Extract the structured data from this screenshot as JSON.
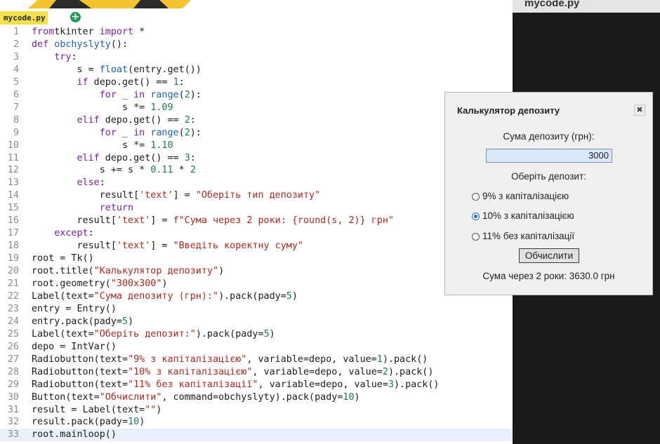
{
  "tab": {
    "file_name": "mycode.py",
    "add_icon": "plus-circle-icon",
    "add_glyph": "+"
  },
  "right_panel": {
    "title": "mycode.py"
  },
  "code_lines": [
    {
      "n": "1",
      "segs": [
        [
          "kw",
          "from"
        ],
        [
          "",
          "tkinter "
        ],
        [
          "kw",
          "import"
        ],
        [
          "",
          " *"
        ]
      ]
    },
    {
      "n": "2",
      "segs": [
        [
          "kw",
          "def"
        ],
        [
          "",
          " "
        ],
        [
          "fn",
          "obchyslyty"
        ],
        [
          "",
          "():"
        ]
      ]
    },
    {
      "n": "3",
      "segs": [
        [
          "",
          "    "
        ],
        [
          "kw",
          "try"
        ],
        [
          "",
          ":"
        ]
      ]
    },
    {
      "n": "4",
      "segs": [
        [
          "",
          "        s = "
        ],
        [
          "fn",
          "float"
        ],
        [
          "",
          "(entry.get())"
        ]
      ]
    },
    {
      "n": "5",
      "segs": [
        [
          "",
          "        "
        ],
        [
          "kw",
          "if"
        ],
        [
          "",
          " depo.get() == "
        ],
        [
          "num",
          "1"
        ],
        [
          "",
          ":"
        ]
      ]
    },
    {
      "n": "6",
      "segs": [
        [
          "",
          "            "
        ],
        [
          "kw",
          "for"
        ],
        [
          "",
          " _ "
        ],
        [
          "kw",
          "in"
        ],
        [
          "",
          " "
        ],
        [
          "fn",
          "range"
        ],
        [
          "",
          "("
        ],
        [
          "num",
          "2"
        ],
        [
          "",
          "):"
        ]
      ]
    },
    {
      "n": "7",
      "segs": [
        [
          "",
          "                s *= "
        ],
        [
          "num",
          "1.09"
        ]
      ]
    },
    {
      "n": "8",
      "segs": [
        [
          "",
          "        "
        ],
        [
          "kw",
          "elif"
        ],
        [
          "",
          " depo.get() == "
        ],
        [
          "num",
          "2"
        ],
        [
          "",
          ":"
        ]
      ]
    },
    {
      "n": "9",
      "segs": [
        [
          "",
          "            "
        ],
        [
          "kw",
          "for"
        ],
        [
          "",
          " _ "
        ],
        [
          "kw",
          "in"
        ],
        [
          "",
          " "
        ],
        [
          "fn",
          "range"
        ],
        [
          "",
          "("
        ],
        [
          "num",
          "2"
        ],
        [
          "",
          "):"
        ]
      ]
    },
    {
      "n": "10",
      "segs": [
        [
          "",
          "                s *= "
        ],
        [
          "num",
          "1.10"
        ]
      ]
    },
    {
      "n": "11",
      "segs": [
        [
          "",
          "        "
        ],
        [
          "kw",
          "elif"
        ],
        [
          "",
          " depo.get() == "
        ],
        [
          "num",
          "3"
        ],
        [
          "",
          ":"
        ]
      ]
    },
    {
      "n": "12",
      "segs": [
        [
          "",
          "            s += s * "
        ],
        [
          "num",
          "0.11"
        ],
        [
          "",
          " * "
        ],
        [
          "num",
          "2"
        ]
      ]
    },
    {
      "n": "13",
      "segs": [
        [
          "",
          "        "
        ],
        [
          "kw",
          "else"
        ],
        [
          "",
          ":"
        ]
      ]
    },
    {
      "n": "14",
      "segs": [
        [
          "",
          "            result["
        ],
        [
          "str",
          "'text'"
        ],
        [
          "",
          "] = "
        ],
        [
          "str",
          "\"Оберіть тип депозиту\""
        ]
      ]
    },
    {
      "n": "15",
      "segs": [
        [
          "",
          "            "
        ],
        [
          "kw",
          "return"
        ]
      ]
    },
    {
      "n": "16",
      "segs": [
        [
          "",
          "        result["
        ],
        [
          "str",
          "'text'"
        ],
        [
          "",
          "] = "
        ],
        [
          "str",
          "f\"Сума через 2 роки: {round(s, 2)} грн\""
        ]
      ]
    },
    {
      "n": "17",
      "segs": [
        [
          "",
          "    "
        ],
        [
          "kw",
          "except"
        ],
        [
          "",
          ":"
        ]
      ]
    },
    {
      "n": "18",
      "segs": [
        [
          "",
          "        result["
        ],
        [
          "str",
          "'text'"
        ],
        [
          "",
          "] = "
        ],
        [
          "str",
          "\"Введіть коректну суму\""
        ]
      ]
    },
    {
      "n": "19",
      "segs": [
        [
          "",
          "root = Tk()"
        ]
      ]
    },
    {
      "n": "20",
      "segs": [
        [
          "",
          "root.title("
        ],
        [
          "str",
          "\"Калькулятор депозиту\""
        ],
        [
          "",
          ")"
        ]
      ]
    },
    {
      "n": "21",
      "segs": [
        [
          "",
          "root.geometry("
        ],
        [
          "str",
          "\"300x300\""
        ],
        [
          "",
          ")"
        ]
      ]
    },
    {
      "n": "22",
      "segs": [
        [
          "",
          "Label(text="
        ],
        [
          "str",
          "\"Сума депозиту (грн):\""
        ],
        [
          "",
          ").pack(pady="
        ],
        [
          "num",
          "5"
        ],
        [
          "",
          ")"
        ]
      ]
    },
    {
      "n": "23",
      "segs": [
        [
          "",
          "entry = Entry()"
        ]
      ]
    },
    {
      "n": "24",
      "segs": [
        [
          "",
          "entry.pack(pady="
        ],
        [
          "num",
          "5"
        ],
        [
          "",
          ")"
        ]
      ]
    },
    {
      "n": "25",
      "segs": [
        [
          "",
          "Label(text="
        ],
        [
          "str",
          "\"Оберіть депозит:\""
        ],
        [
          "",
          ").pack(pady="
        ],
        [
          "num",
          "5"
        ],
        [
          "",
          ")"
        ]
      ]
    },
    {
      "n": "26",
      "segs": [
        [
          "",
          "depo = IntVar()"
        ]
      ]
    },
    {
      "n": "27",
      "segs": [
        [
          "",
          "Radiobutton(text="
        ],
        [
          "str",
          "\"9% з капіталізацією\""
        ],
        [
          "",
          ", variable=depo, value="
        ],
        [
          "num",
          "1"
        ],
        [
          "",
          ").pack()"
        ]
      ]
    },
    {
      "n": "28",
      "segs": [
        [
          "",
          "Radiobutton(text="
        ],
        [
          "str",
          "\"10% з капіталізацією\""
        ],
        [
          "",
          ", variable=depo, value="
        ],
        [
          "num",
          "2"
        ],
        [
          "",
          ").pack()"
        ]
      ]
    },
    {
      "n": "29",
      "segs": [
        [
          "",
          "Radiobutton(text="
        ],
        [
          "str",
          "\"11% без капіталізації\""
        ],
        [
          "",
          ", variable=depo, value="
        ],
        [
          "num",
          "3"
        ],
        [
          "",
          ").pack()"
        ]
      ]
    },
    {
      "n": "30",
      "segs": [
        [
          "",
          "Button(text="
        ],
        [
          "str",
          "\"Обчислити\""
        ],
        [
          "",
          ", command=obchyslyty).pack(pady="
        ],
        [
          "num",
          "10"
        ],
        [
          "",
          ")"
        ]
      ]
    },
    {
      "n": "31",
      "segs": [
        [
          "",
          "result = Label(text="
        ],
        [
          "str",
          "\"\""
        ],
        [
          "",
          ")"
        ]
      ]
    },
    {
      "n": "32",
      "segs": [
        [
          "",
          "result.pack(pady="
        ],
        [
          "num",
          "10"
        ],
        [
          "",
          ")"
        ]
      ]
    },
    {
      "n": "33",
      "segs": [
        [
          "",
          "root.mainloop()"
        ]
      ]
    }
  ],
  "active_line": 33,
  "tk_window": {
    "title": "Калькулятор депозиту",
    "close_glyph": "✖",
    "amount_label": "Сума депозиту (грн):",
    "amount_value": "3000",
    "choose_label": "Оберіть депозит:",
    "options": [
      "9% з капіталізацією",
      "10% з капіталізацією",
      "11% без капіталізації"
    ],
    "selected_option": 1,
    "calc_button": "Обчислити",
    "result": "Сума через 2 роки: 3630.0 грн"
  },
  "colors": {
    "tab_bg": "#f6e04a",
    "add_icon": "#1f9d55",
    "keyword": "#7a1fa2",
    "string": "#b0271f",
    "number": "#1a7b4f",
    "builtin": "#1c5fb8"
  }
}
